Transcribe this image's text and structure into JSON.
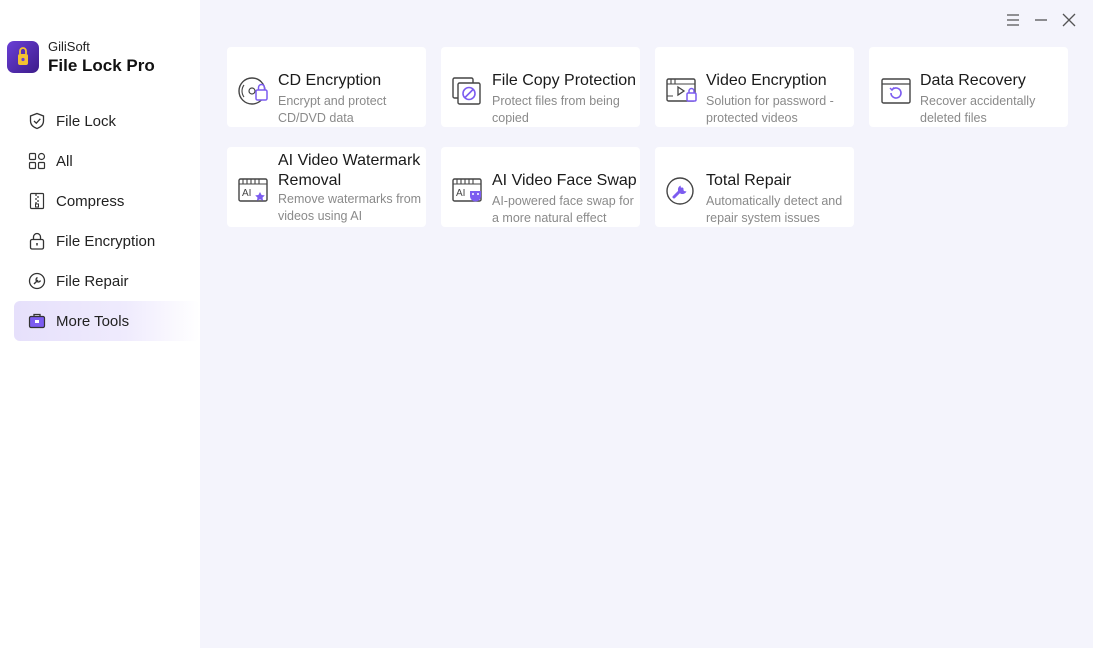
{
  "app": {
    "vendor": "GiliSoft",
    "name": "File Lock Pro"
  },
  "sidebar": {
    "items": [
      {
        "label": "File Lock",
        "icon": "shield-icon"
      },
      {
        "label": "All",
        "icon": "grid-icon"
      },
      {
        "label": "Compress",
        "icon": "zip-icon"
      },
      {
        "label": "File Encryption",
        "icon": "padlock-icon"
      },
      {
        "label": "File Repair",
        "icon": "repair-icon"
      },
      {
        "label": "More Tools",
        "icon": "toolbox-icon",
        "active": true
      }
    ]
  },
  "window_controls": {
    "menu": "menu-icon",
    "minimize": "minimize-icon",
    "close": "close-icon"
  },
  "tools": [
    {
      "title": "CD Encryption",
      "desc": "Encrypt and protect CD/DVD data",
      "icon": "cd-lock-icon"
    },
    {
      "title": "File Copy Protection",
      "desc": "Protect files from being copied",
      "icon": "copy-protect-icon"
    },
    {
      "title": "Video Encryption",
      "desc": "Solution for password - protected videos",
      "icon": "video-lock-icon"
    },
    {
      "title": "Data Recovery",
      "desc": "Recover accidentally deleted files",
      "icon": "data-recovery-icon"
    },
    {
      "title": "AI Video Watermark Removal",
      "desc": "Remove watermarks from videos using AI",
      "icon": "ai-watermark-icon"
    },
    {
      "title": "AI Video Face Swap",
      "desc": "AI-powered face swap for a more natural effect",
      "icon": "ai-face-swap-icon"
    },
    {
      "title": "Total Repair",
      "desc": "Automatically detect and repair system issues",
      "icon": "total-repair-icon"
    }
  ],
  "colors": {
    "accent": "#7c5cf0",
    "background": "#f4f4fc",
    "active_nav": "#e6e0fb"
  }
}
